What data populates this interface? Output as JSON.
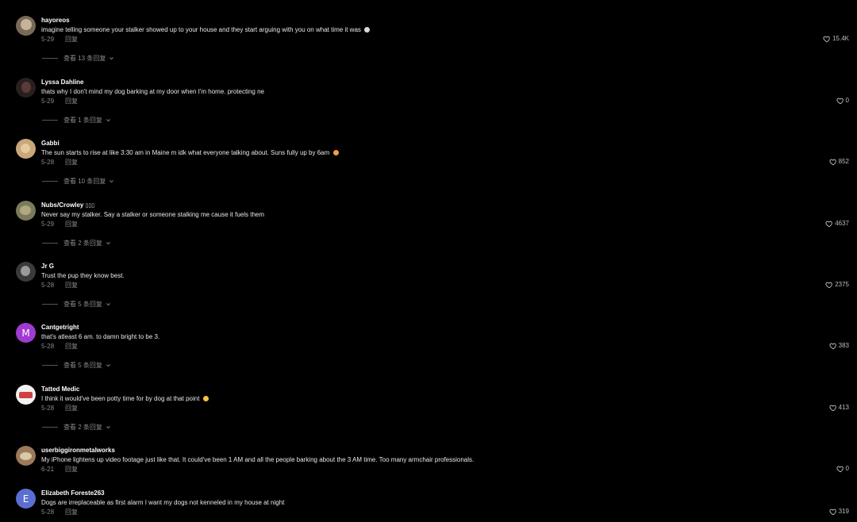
{
  "comments": [
    {
      "username": "hayoreos",
      "text": "imagine telling someone your stalker showed up to your house and they start arguing with you on what time it was",
      "emoji": "skull",
      "date": "5-29",
      "reply_label": "回复",
      "likes": "15.4K",
      "view_replies": "查看 13 条回复",
      "avatar_color": "#7a6a55"
    },
    {
      "username": "Lyssa Dahline",
      "text": "thats why I don't mind my dog barking at my door when I'm home. protecting ne",
      "date": "5-29",
      "reply_label": "回复",
      "likes": "0",
      "view_replies": "查看 1 条回复",
      "avatar_color": "#3a2a2a"
    },
    {
      "username": "Gabbi",
      "text": "The sun starts to rise at like 3:30 am in Maine m idk what everyone talking about. Suns fully up by 6am",
      "emoji": "laughing",
      "date": "5-28",
      "reply_label": "回复",
      "likes": "852",
      "view_replies": "查看 10 条回复",
      "avatar_color": "#c9a77a"
    },
    {
      "username": "Nubs/Crowley",
      "username_suffix": "▯▯▯",
      "text": "Never say my stalker. Say a stalker or someone stalking me cause it fuels them",
      "date": "5-29",
      "reply_label": "回复",
      "likes": "4637",
      "view_replies": "查看 2 条回复",
      "avatar_color": "#8a8a6a"
    },
    {
      "username": "Jr G",
      "text": "Trust the pup they know best.",
      "date": "5-28",
      "reply_label": "回复",
      "likes": "2375",
      "view_replies": "查看 5 条回复",
      "avatar_color": "#4a4a4a"
    },
    {
      "username": "Cantgetright",
      "text": "that's atleast 6 am. to damn bright to be 3.",
      "date": "5-28",
      "reply_label": "回复",
      "likes": "383",
      "view_replies": "查看 5 条回复",
      "avatar_letter": "M",
      "avatar_color": "#a03ad0"
    },
    {
      "username": "Tatted Medic",
      "text": "I think it would've been potty time for by dog at that point",
      "emoji": "smile",
      "date": "5-28",
      "reply_label": "回复",
      "likes": "413",
      "view_replies": "查看 2 条回复",
      "avatar_color": "#e8e8e8"
    },
    {
      "username": "userbiggironmetalworks",
      "text": "My iPhone lightens up video footage just like that. It could've been 1 AM and all the people barking about the 3 AM time. Too many armchair professionals.",
      "date": "6-21",
      "reply_label": "回复",
      "likes": "0",
      "avatar_color": "#9a7a5a"
    },
    {
      "username": "Elizabeth Foreste263",
      "text": "Dogs are irreplaceable as first alarm I want my dogs not kenneled in my house at night",
      "date": "5-28",
      "reply_label": "回复",
      "likes": "319",
      "avatar_letter": "E",
      "avatar_color": "#5b6fd0"
    }
  ],
  "colors": {
    "background": "#000000",
    "username": "#ffffff",
    "meta": "#8a8a8a",
    "emoji_yellow": "#f5c242"
  }
}
